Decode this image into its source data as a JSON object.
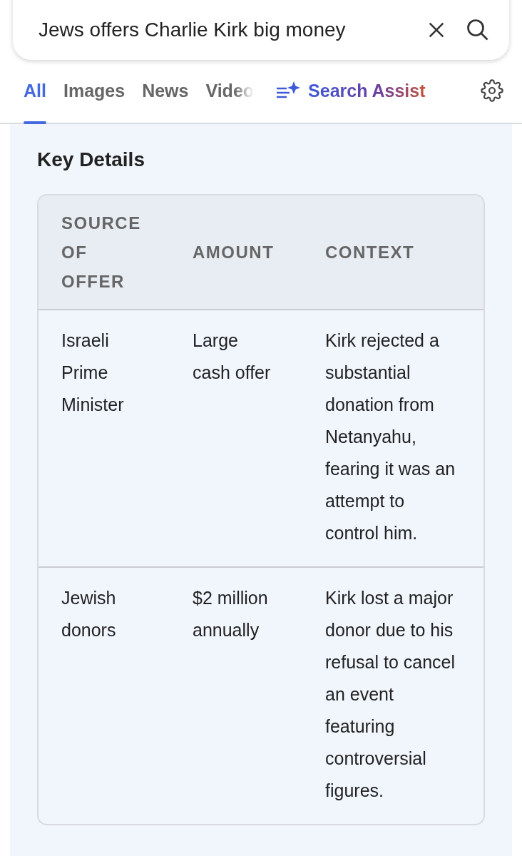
{
  "search": {
    "value": "Jews offers Charlie Kirk big money"
  },
  "tabs": [
    {
      "label": "All",
      "selected": true,
      "kind": "plain"
    },
    {
      "label": "Images",
      "selected": false,
      "kind": "plain"
    },
    {
      "label": "News",
      "selected": false,
      "kind": "plain"
    },
    {
      "label": "Video",
      "selected": false,
      "kind": "faded"
    },
    {
      "label": "Search Assist",
      "selected": false,
      "kind": "assist"
    }
  ],
  "section": {
    "title": "Key Details"
  },
  "table": {
    "columns": [
      "SOURCE OF OFFER",
      "AMOUNT",
      "CONTEXT"
    ],
    "rows": [
      [
        "Israeli Prime Minister",
        "Large cash offer",
        "Kirk rejected a substantial donation from Netanyahu, fearing it was an attempt to control him."
      ],
      [
        "Jewish donors",
        "$2 million annually",
        "Kirk lost a major donor due to his refusal to cancel an event featuring controversial figures."
      ]
    ]
  }
}
